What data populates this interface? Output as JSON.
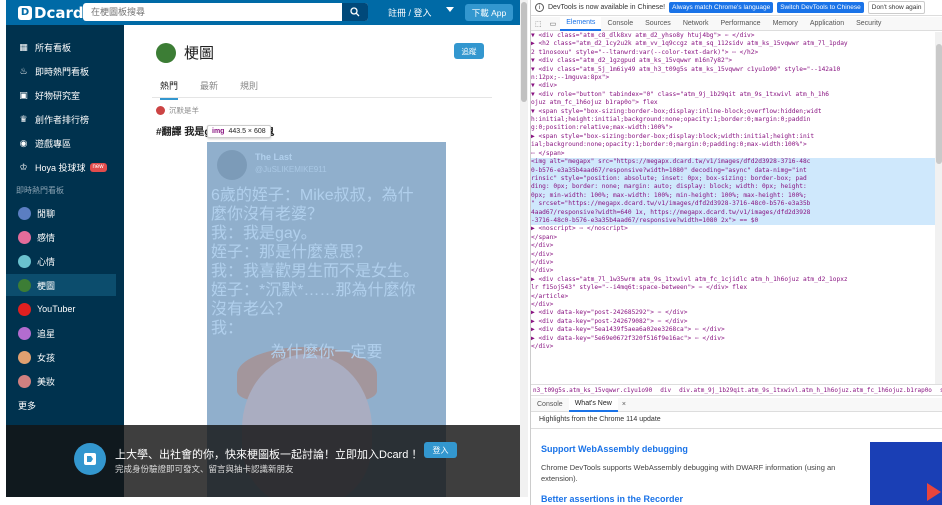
{
  "site": {
    "logo_text": "Dcard",
    "search_placeholder": "在梗圖板搜尋",
    "register_label": "註冊 / 登入",
    "download_label": "下載 App",
    "sidebar": {
      "items": [
        {
          "label": "所有看板",
          "icon": "grid-icon"
        },
        {
          "label": "即時熱門看板",
          "icon": "fire-icon"
        },
        {
          "label": "好物研究室",
          "icon": "box-icon"
        },
        {
          "label": "創作者排行榜",
          "icon": "trophy-icon"
        },
        {
          "label": "遊戲專區",
          "icon": "gamepad-icon"
        },
        {
          "label": "Hoya 投球球",
          "icon": "crown-icon",
          "badge": "new"
        }
      ],
      "section_label": "即時熱門看板",
      "boards": [
        {
          "label": "閒聊",
          "color": "#5b7ec2"
        },
        {
          "label": "感情",
          "color": "#e36c9a"
        },
        {
          "label": "心情",
          "color": "#6ac2cf"
        },
        {
          "label": "梗圖",
          "color": "#3c7d35",
          "active": true
        },
        {
          "label": "YouTuber",
          "color": "#e02020"
        },
        {
          "label": "追星",
          "color": "#b36ccf"
        },
        {
          "label": "女孩",
          "color": "#e0a070"
        },
        {
          "label": "美妝",
          "color": "#d08080"
        }
      ],
      "more_label": "更多"
    },
    "feed": {
      "board_name": "梗圖",
      "follow_label": "追蹤",
      "tabs": [
        "熱門",
        "最新",
        "規則"
      ],
      "post": {
        "author": "沉默是羊",
        "title": "#翻譯 我是gay 我說的小鬼"
      },
      "inspect_tooltip": {
        "tag": "img",
        "size": "443.5 × 608"
      },
      "image": {
        "name": "The Last",
        "handle": "@JuSLIKEMIKE911",
        "lines": [
          "6歲的姪子：Mike叔叔，為什",
          "麼你沒有老婆？",
          "我：我是gay。",
          "姪子：那是什麼意思？",
          "我：我喜歡男生而不是女生。",
          "姪子：*沉默*……那為什麼你",
          "沒有老公？",
          "我："
        ],
        "caption": "為什麼你一定要"
      }
    },
    "banner": {
      "title": "上大學、出社會的你，快來梗圖板一起討論！立即加入Dcard ！",
      "subtitle": "完成身份驗證即可發文、留言與抽卡認識新朋友",
      "button_label": "登入"
    }
  },
  "devtools": {
    "info_text": "DevTools is now available in Chinese!",
    "btn_match": "Always match Chrome's language",
    "btn_switch": "Switch DevTools to Chinese",
    "btn_dont_show": "Don't show again",
    "tabs": [
      "Elements",
      "Console",
      "Sources",
      "Network",
      "Performance",
      "Memory",
      "Application",
      "Security"
    ],
    "active_tab": "Elements",
    "dom_lines": [
      "▼ <div class=\"atm_c8_dlk8xv atm_d2_yhso8y htuj4bg\"> ⋯ </div>",
      "  ▶ <h2 class=\"atm_d2_1cy2u2k atm_vv_1q9ccgz atm_sq_112sidv atm_ks_15vqwwr atm_7l_1pday",
      "     2 t1nosoxu\" style=\"--ltanwrd:var(--color-text-dark)\"> ⋯ </h2>",
      "  ▼ <div class=\"atm_d2_1gzgpud atm_ks_15vqwwr m16n7y82\">",
      "    ▼ <div class=\"atm_5j_1m6iy49 atm_h3_t09g5s atm_ks_15vqwwr c1yu1o90\" style=\"--142a10",
      "       n:12px;--1mguva:8px\">",
      "      ▼ <div>",
      "        ▼ <div role=\"button\" tabindex=\"0\" class=\"atm_9j_1b29qit atm_9s_1txwivl atm_h_1h6",
      "           ojuz atm_fc_1h6ojuz b1rap0o\"> flex",
      "          ▼ <span style=\"box-sizing:border-box;display:inline-block;overflow:hidden;widt",
      "             h:initial;height:initial;background:none;opacity:1;border:0;margin:0;paddin",
      "             g:0;position:relative;max-width:100%\">",
      "            ▶ <span style=\"box-sizing:border-box;display:block;width:initial;height:init",
      "               ial;background:none;opacity:1;border:0;margin:0;padding:0;max-width:100%\">",
      "               ⋯ </span>",
      "              <img alt=\"megapx\" src=\"https://megapx.dcard.tw/v1/images/dfd2d3928-3716-48c",
      "               0-b576-e3a35b4aad67/responsive?width=1080\" decoding=\"async\" data-nimg=\"int",
      "               rinsic\" style=\"position: absolute; inset: 0px; box-sizing: border-box; pad",
      "               ding: 0px; border: none; margin: auto; display: block; width: 0px; height:",
      "               0px; min-width: 100%; max-width: 100%; min-height: 100%; max-height: 100%;",
      "               \" srcset=\"https://megapx.dcard.tw/v1/images/dfd2d3928-3716-48c0-b576-e3a35b",
      "               4aad67/responsive?width=640 1x, https://megapx.dcard.tw/v1/images/dfd2d3928",
      "               -3716-48c0-b576-e3a35b4aad67/responsive?width=1080 2x\"> == $0",
      "            ▶ <noscript> ⋯ </noscript>",
      "            </span>",
      "          </div>",
      "        </div>",
      "      </div>",
      "    </div>",
      "  ▶ <div class=\"atm_7l_1w35wrm atm_9s_1txwivl atm_fc_1cjidlc atm_h_1h6ojuz atm_d2_1opxz",
      "     lr f15oj543\" style=\"--i4mq6t:space-between\"> ⋯ </div> flex",
      "  </article>",
      "</div>",
      "▶ <div data-key=\"post-242685292\"> ⋯ </div>",
      "▶ <div data-key=\"post-242679082\"> ⋯ </div>",
      "▶ <div data-key=\"5ea1439f5aea6a02ee3268ca\"> ⋯ </div>",
      "▶ <div data-key=\"5e69e0672f320f516f9e16ac\"> ⋯ </div>",
      "</div>"
    ],
    "selected_line_start": 15,
    "selected_line_end": 22,
    "breadcrumb": [
      "n3_t09g5s.atm_ks_15vqwwr.c1yu1o90",
      "div",
      "div.atm_9j_1b29qit.atm_9s_1txwivl.atm_h_1h6ojuz.atm_fc_1h6ojuz.b1rap0o",
      "span",
      "img"
    ],
    "drawer_tabs": [
      "Console",
      "What's New"
    ],
    "drawer_active": "What's New",
    "whats_new_header": "Highlights from the Chrome 114 update",
    "wn_title1": "Support WebAssembly debugging",
    "wn_desc1": "Chrome DevTools supports WebAssembly debugging with DWARF information (using an extension).",
    "wn_title2": "Better assertions in the Recorder"
  }
}
